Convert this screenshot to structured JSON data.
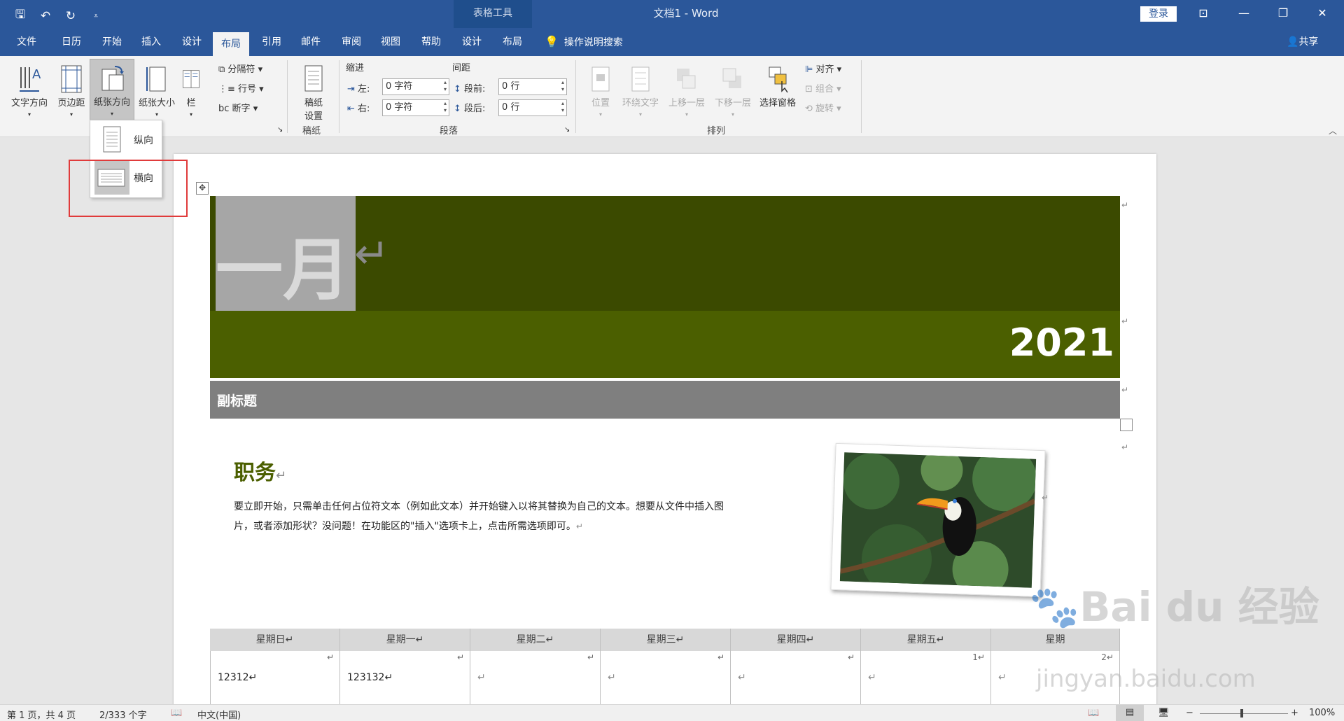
{
  "titlebar": {
    "qat_save": "🖫",
    "qat_undo": "↶",
    "qat_redo": "↻",
    "qat_more": "⩡",
    "context_tab": "表格工具",
    "doc_title": "文档1 - Word",
    "login": "登录",
    "ribbon_display": "⊡",
    "minimize": "—",
    "restore": "❐",
    "close": "✕"
  },
  "tabs": [
    "文件",
    "日历",
    "开始",
    "插入",
    "设计",
    "布局",
    "引用",
    "邮件",
    "审阅",
    "视图",
    "帮助",
    "设计",
    "布局"
  ],
  "active_tab": "布局",
  "tell_me": "操作说明搜索",
  "share": "共享",
  "ribbon": {
    "page_setup": {
      "text_direction": "文字方向",
      "margins": "页边距",
      "orientation": "纸张方向",
      "size": "纸张大小",
      "columns": "栏",
      "breaks": "分隔符",
      "line_numbers": "行号",
      "hyphenation": "断字"
    },
    "manuscript": {
      "button": "稿纸\n设置",
      "button_line1": "稿纸",
      "button_line2": "设置",
      "group": "稿纸"
    },
    "paragraph": {
      "indent_label": "缩进",
      "spacing_label": "间距",
      "left_label": "左:",
      "left_value": "0 字符",
      "right_label": "右:",
      "right_value": "0 字符",
      "before_label": "段前:",
      "before_value": "0 行",
      "after_label": "段后:",
      "after_value": "0 行",
      "group": "段落"
    },
    "arrange": {
      "position": "位置",
      "wrap_text": "环绕文字",
      "bring_forward": "上移一层",
      "send_backward": "下移一层",
      "selection_pane": "选择窗格",
      "align": "对齐",
      "group_btn": "组合",
      "rotate": "旋转",
      "group": "排列"
    }
  },
  "orientation_menu": {
    "portrait": "纵向",
    "landscape": "横向"
  },
  "document": {
    "month": "一月",
    "year": "2021",
    "subtitle": "副标题",
    "duty_title": "职务",
    "body_line1": "要立即开始，只需单击任何占位符文本（例如此文本）并开始键入以将其替换为自己的文本。想要从文件中插入图",
    "body_line2": "片，或者添加形状？没问题！在功能区的\"插入\"选项卡上，点击所需选项即可。",
    "para_mark": "↵",
    "calendar": {
      "headers": [
        "星期日",
        "星期一",
        "星期二",
        "星期三",
        "星期四",
        "星期五",
        "星期六"
      ],
      "header_shown": [
        "星期日↵",
        "星期一↵",
        "星期二↵",
        "星期三↵",
        "星期四↵",
        "星期五↵",
        "星期"
      ],
      "dates": [
        "12312↵",
        "123132↵",
        "↵",
        "↵",
        "↵",
        "↵",
        "↵"
      ],
      "corner_marks": [
        "↵",
        "↵",
        "↵",
        "↵",
        "↵",
        "1↵",
        "2↵"
      ]
    }
  },
  "watermark": {
    "brand": "Bai du 经验",
    "url": "jingyan.baidu.com"
  },
  "status": {
    "page": "第 1 页，共 4 页",
    "words": "2/333 个字",
    "language": "中文(中国)",
    "zoom": "100%",
    "zoom_minus": "−",
    "zoom_plus": "+"
  },
  "colors": {
    "word_blue": "#2b579a",
    "header_dark": "#3b4a00",
    "header_green": "#4b5f00",
    "subtitle_gray": "#7f7f7f",
    "highlight_red": "#e03b3b"
  }
}
